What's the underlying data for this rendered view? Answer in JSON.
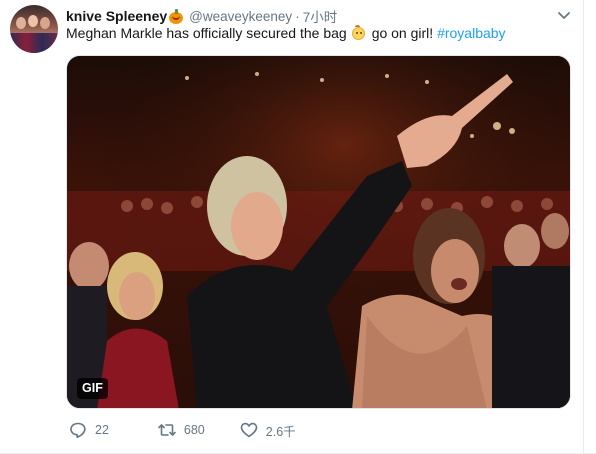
{
  "tweet": {
    "author": {
      "display_name": "knive Spleeney",
      "name_emoji_icon": "jack-o-lantern-icon",
      "handle": "@weaveykeeney",
      "separator": "·",
      "time": "7小时"
    },
    "text": {
      "before_emoji": "Meghan Markle has officially secured the bag",
      "emoji_icon": "baby-face-icon",
      "after_emoji": "go on girl!",
      "hashtag": "#royalbaby"
    },
    "media": {
      "type": "gif",
      "badge_label": "GIF"
    },
    "actions": {
      "reply": {
        "icon": "reply-icon",
        "count": "22"
      },
      "retweet": {
        "icon": "retweet-icon",
        "count": "680"
      },
      "like": {
        "icon": "heart-icon",
        "count": "2.6千"
      }
    },
    "menu_icon": "chevron-down-icon"
  },
  "colors": {
    "text_primary": "#14171a",
    "text_secondary": "#657786",
    "link_blue": "#1da1f2",
    "border": "#e6ecf0"
  }
}
